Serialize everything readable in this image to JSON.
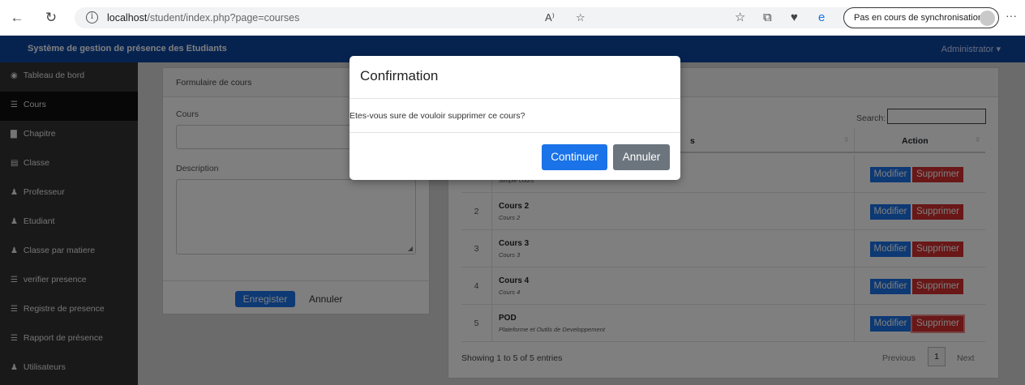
{
  "browser": {
    "url_host": "localhost",
    "url_path": "/student/index.php?page=courses",
    "sync_label": "Pas en cours de synchronisation"
  },
  "topbar": {
    "brand": "Système de gestion de présence des Etudiants",
    "user": "Administrator ▾"
  },
  "sidebar": {
    "items": [
      {
        "icon": "◉",
        "label": "Tableau de bord"
      },
      {
        "icon": "☰",
        "label": "Cours"
      },
      {
        "icon": "▇",
        "label": "Chapitre"
      },
      {
        "icon": "▤",
        "label": "Classe"
      },
      {
        "icon": "♟",
        "label": "Professeur"
      },
      {
        "icon": "♟",
        "label": "Etudiant"
      },
      {
        "icon": "♟",
        "label": "Classe par matiere"
      },
      {
        "icon": "☰",
        "label": "verifier presence"
      },
      {
        "icon": "☰",
        "label": "Registre de presence"
      },
      {
        "icon": "☰",
        "label": "Rapport de présence"
      },
      {
        "icon": "♟",
        "label": "Utilisateurs"
      }
    ]
  },
  "form": {
    "title": "Formulaire de cours",
    "course_label": "Cours",
    "course_value": "",
    "description_label": "Description",
    "description_value": "",
    "save_label": "Enregister",
    "cancel_label": "Annuler"
  },
  "table": {
    "search_label": "Search:",
    "search_value": "",
    "header_course_tail": "s",
    "header_action": "Action",
    "rows": [
      {
        "num": "1",
        "name": "",
        "desc": "Simple cours"
      },
      {
        "num": "2",
        "name": "Cours 2",
        "desc": "Cours 2"
      },
      {
        "num": "3",
        "name": "Cours 3",
        "desc": "Cours 3"
      },
      {
        "num": "4",
        "name": "Cours 4",
        "desc": "Cours 4"
      },
      {
        "num": "5",
        "name": "POD",
        "desc": "Plateforme et Outils de Developpement"
      }
    ],
    "modify_label": "Modifier",
    "delete_label": "Supprimer",
    "info": "Showing 1 to 5 of 5 entries",
    "previous": "Previous",
    "page": "1",
    "next": "Next"
  },
  "modal": {
    "title": "Confirmation",
    "body": "Etes-vous sure de vouloir supprimer ce cours?",
    "continue_label": "Continuer",
    "cancel_label": "Annuler"
  },
  "colors": {
    "navbar": "#0d47a1",
    "sidebar": "#323232",
    "primary": "#1a73e8",
    "danger": "#d32f2f",
    "secondary": "#6c757d",
    "overlay": "rgba(0,0,0,0.5)"
  }
}
